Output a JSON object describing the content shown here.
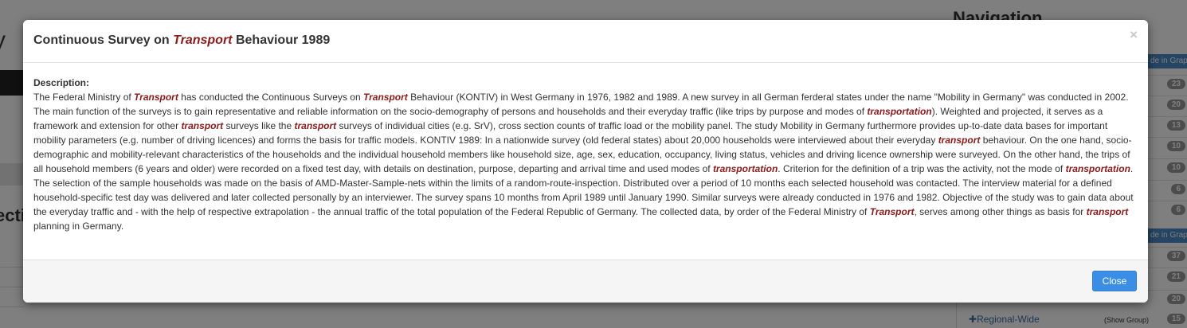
{
  "background": {
    "left_title": "y",
    "left_section": "ecti",
    "nav_title": "Navigation",
    "group_header_label": "de in Graph",
    "badges": [
      "23",
      "20",
      "13",
      "10",
      "10",
      "6",
      "6"
    ],
    "badges_lower": [
      "37",
      "21",
      "20",
      "15"
    ],
    "show_group_label": "(Show Group)",
    "regional_label": "Regional-Wide"
  },
  "modal": {
    "title_prefix": "Continuous Survey on ",
    "title_highlight": "Transport",
    "title_suffix": " Behaviour 1989",
    "close_symbol": "×",
    "description_label": "Description:",
    "description_segments": [
      {
        "text": "The Federal Ministry of ",
        "hl": false
      },
      {
        "text": "Transport",
        "hl": true
      },
      {
        "text": " has conducted the Continuous Surveys on ",
        "hl": false
      },
      {
        "text": "Transport",
        "hl": true
      },
      {
        "text": " Behaviour (KONTIV) in West Germany in 1976, 1982 and 1989. A new survey in all German ferderal states under the name \"Mobility in Germany\" was conducted in 2002. The main function of the surveys is to gain representative and reliable information on the socio-demography of persons and households and their everyday traffic (like trips by purpose and modes of ",
        "hl": false
      },
      {
        "text": "transportation",
        "hl": true
      },
      {
        "text": "). Weighted and projected, it serves as a framework and extension for other ",
        "hl": false
      },
      {
        "text": "transport",
        "hl": true
      },
      {
        "text": " surveys like the ",
        "hl": false
      },
      {
        "text": "transport",
        "hl": true
      },
      {
        "text": " surveys of individual cities (e.g. SrV), cross section counts of traffic load or the mobility panel. The study Mobility in Germany furthermore provides up-to-date data bases for important mobility parameters (e.g. number of driving licences) and forms the basis for traffic models. KONTIV 1989: In a nationwide survey (old federal states) about 20,000 households were interviewed about their everyday ",
        "hl": false
      },
      {
        "text": "transport",
        "hl": true
      },
      {
        "text": " behaviour. On the one hand, socio-demographic and mobility-relevant characteristics of the households and the individual household members like household size, age, sex, education, occupancy, living status, vehicles and driving licence ownership were surveyed. On the other hand, the trips of all household members (6 years and older) were recorded on a fixed test day, with details on destination, purpose, departing and arrival time and used modes of ",
        "hl": false
      },
      {
        "text": "transportation",
        "hl": true
      },
      {
        "text": ". Criterion for the definition of a trip was the activity, not the mode of ",
        "hl": false
      },
      {
        "text": "transportation",
        "hl": true
      },
      {
        "text": ". The selection of the sample households was made on the basis of AMD-Master-Sample-nets within the limits of a random-route-inspection. Distributed over a period of 10 months each selected household was contacted. The interview material for a defined household-specific test day was delivered and later collected personally by an interviewer. The survey spans 10 months from April 1989 until January 1990. Similar surveys were already conducted in 1976 and 1982. Objective of the study was to gain data about the everyday traffic and - with the help of respective extrapolation - the annual traffic of the total population of the Federal Republic of Germany. The collected data, by order of the Federal Ministry of ",
        "hl": false
      },
      {
        "text": "Transport",
        "hl": true
      },
      {
        "text": ", serves among other things as basis for ",
        "hl": false
      },
      {
        "text": "transport",
        "hl": true
      },
      {
        "text": " planning in Germany.",
        "hl": false
      }
    ],
    "close_button_label": "Close"
  },
  "colors": {
    "highlight": "#8b1a1a",
    "primary_button": "#3a8ee6"
  }
}
